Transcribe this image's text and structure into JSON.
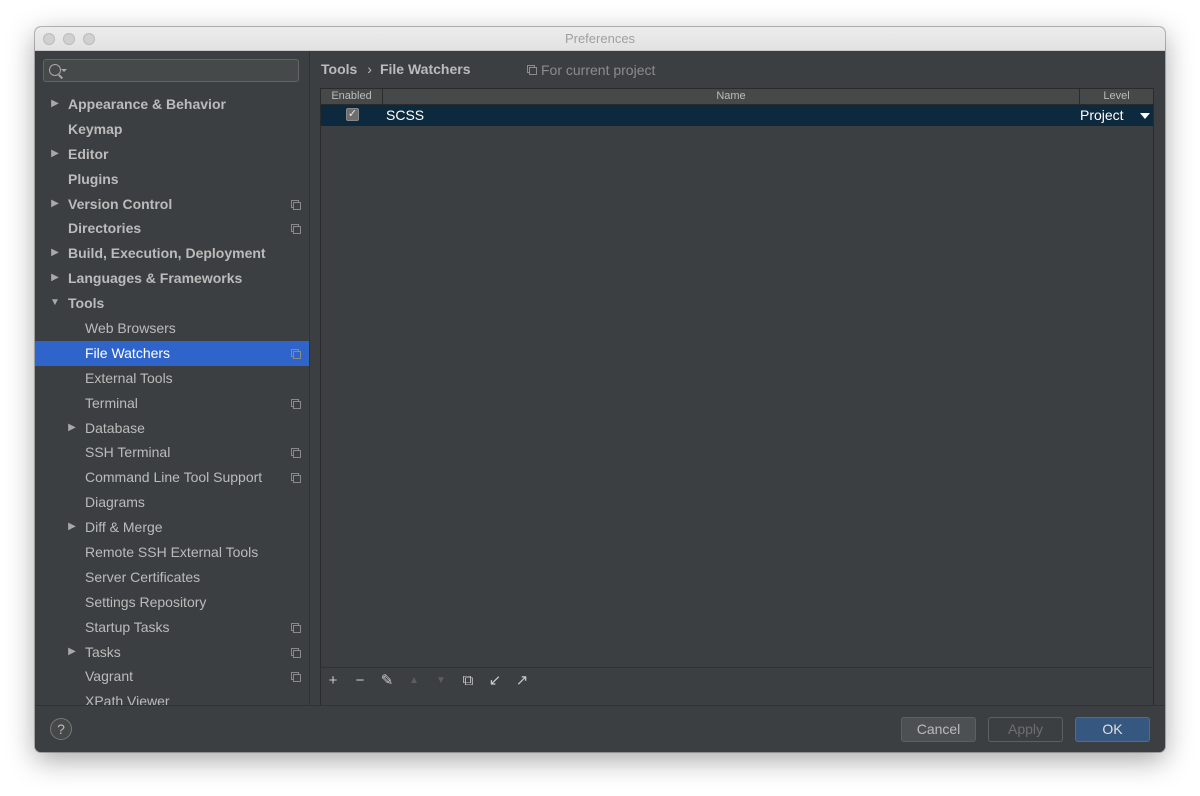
{
  "window": {
    "title": "Preferences"
  },
  "search": {
    "value": "",
    "placeholder": ""
  },
  "sidebar": {
    "items": [
      {
        "label": "Appearance & Behavior",
        "level": 0,
        "arrow": "▶",
        "bold": true,
        "copy_icon": false,
        "selected": false
      },
      {
        "label": "Keymap",
        "level": 0,
        "arrow": "",
        "bold": true,
        "copy_icon": false,
        "selected": false
      },
      {
        "label": "Editor",
        "level": 0,
        "arrow": "▶",
        "bold": true,
        "copy_icon": false,
        "selected": false
      },
      {
        "label": "Plugins",
        "level": 0,
        "arrow": "",
        "bold": true,
        "copy_icon": false,
        "selected": false
      },
      {
        "label": "Version Control",
        "level": 0,
        "arrow": "▶",
        "bold": true,
        "copy_icon": true,
        "selected": false
      },
      {
        "label": "Directories",
        "level": 0,
        "arrow": "",
        "bold": true,
        "copy_icon": true,
        "selected": false
      },
      {
        "label": "Build, Execution, Deployment",
        "level": 0,
        "arrow": "▶",
        "bold": true,
        "copy_icon": false,
        "selected": false
      },
      {
        "label": "Languages & Frameworks",
        "level": 0,
        "arrow": "▶",
        "bold": true,
        "copy_icon": false,
        "selected": false
      },
      {
        "label": "Tools",
        "level": 0,
        "arrow": "▼",
        "bold": true,
        "copy_icon": false,
        "selected": false
      },
      {
        "label": "Web Browsers",
        "level": 1,
        "arrow": "",
        "bold": false,
        "copy_icon": false,
        "selected": false
      },
      {
        "label": "File Watchers",
        "level": 1,
        "arrow": "",
        "bold": false,
        "copy_icon": true,
        "selected": true
      },
      {
        "label": "External Tools",
        "level": 1,
        "arrow": "",
        "bold": false,
        "copy_icon": false,
        "selected": false
      },
      {
        "label": "Terminal",
        "level": 1,
        "arrow": "",
        "bold": false,
        "copy_icon": true,
        "selected": false
      },
      {
        "label": "Database",
        "level": 1,
        "arrow": "▶",
        "bold": false,
        "copy_icon": false,
        "selected": false
      },
      {
        "label": "SSH Terminal",
        "level": 1,
        "arrow": "",
        "bold": false,
        "copy_icon": true,
        "selected": false
      },
      {
        "label": "Command Line Tool Support",
        "level": 1,
        "arrow": "",
        "bold": false,
        "copy_icon": true,
        "selected": false
      },
      {
        "label": "Diagrams",
        "level": 1,
        "arrow": "",
        "bold": false,
        "copy_icon": false,
        "selected": false
      },
      {
        "label": "Diff & Merge",
        "level": 1,
        "arrow": "▶",
        "bold": false,
        "copy_icon": false,
        "selected": false
      },
      {
        "label": "Remote SSH External Tools",
        "level": 1,
        "arrow": "",
        "bold": false,
        "copy_icon": false,
        "selected": false
      },
      {
        "label": "Server Certificates",
        "level": 1,
        "arrow": "",
        "bold": false,
        "copy_icon": false,
        "selected": false
      },
      {
        "label": "Settings Repository",
        "level": 1,
        "arrow": "",
        "bold": false,
        "copy_icon": false,
        "selected": false
      },
      {
        "label": "Startup Tasks",
        "level": 1,
        "arrow": "",
        "bold": false,
        "copy_icon": true,
        "selected": false
      },
      {
        "label": "Tasks",
        "level": 1,
        "arrow": "▶",
        "bold": false,
        "copy_icon": true,
        "selected": false
      },
      {
        "label": "Vagrant",
        "level": 1,
        "arrow": "",
        "bold": false,
        "copy_icon": true,
        "selected": false
      },
      {
        "label": "XPath Viewer",
        "level": 1,
        "arrow": "",
        "bold": false,
        "copy_icon": false,
        "selected": false
      }
    ]
  },
  "content": {
    "breadcrumb": {
      "parent": "Tools",
      "separator": "›",
      "current": "File Watchers"
    },
    "scope_note": "For current project",
    "table": {
      "headers": {
        "enabled": "Enabled",
        "name": "Name",
        "level": "Level"
      },
      "rows": [
        {
          "enabled": true,
          "check_glyph": "✓",
          "name": "SCSS",
          "level": "Project"
        }
      ]
    },
    "toolbar": {
      "add": "+",
      "remove": "−",
      "edit": "✎",
      "move_up": "▲",
      "move_down": "▼",
      "copy": "⧉",
      "import": "↙",
      "export": "↗"
    }
  },
  "footer": {
    "help": "?",
    "cancel": "Cancel",
    "apply": "Apply",
    "ok": "OK"
  },
  "colors": {
    "selection": "#2f65ca",
    "table_row_selection": "#0d293e",
    "ok_button": "#365880",
    "panel_bg": "#3c3f41"
  }
}
